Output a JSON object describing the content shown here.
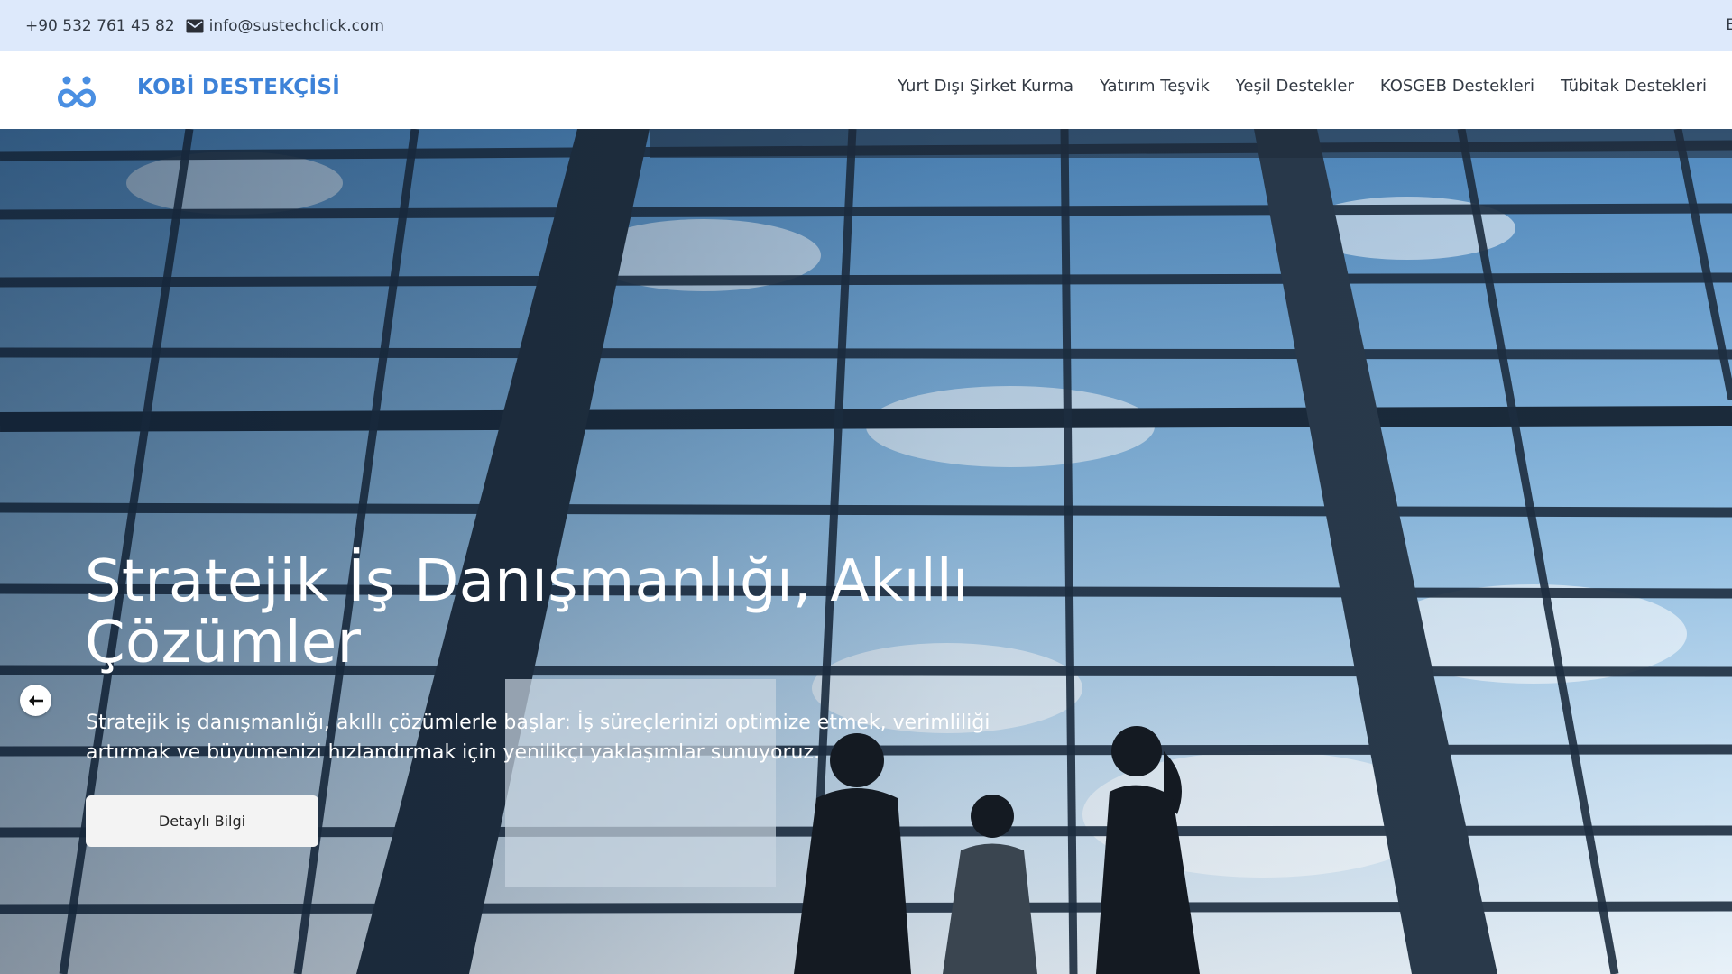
{
  "topbar": {
    "phone": "+90 532 761 45 82",
    "email": "info@sustechclick.com",
    "edge_char": "E"
  },
  "header": {
    "brand": "KOBİ DESTEKÇİSİ",
    "nav": [
      {
        "label": "Yurt Dışı Şirket Kurma"
      },
      {
        "label": "Yatırım Teşvik"
      },
      {
        "label": "Yeşil Destekler"
      },
      {
        "label": "KOSGEB Destekleri"
      },
      {
        "label": "Tübitak Destekleri"
      }
    ]
  },
  "hero": {
    "title": "Stratejik İş Danışmanlığı, Akıllı Çözümler",
    "description": "Stratejik iş danışmanlığı, akıllı çözümlerle başlar: İş süreçlerinizi optimize etmek, verimliliği artırmak ve büyümenizi hızlandırmak için yenilikçi yaklaşımlar sunuyoruz.",
    "button_label": "Detaylı Bilgi"
  },
  "colors": {
    "topbar_bg": "#dde9fb",
    "brand": "#3d82d8",
    "nav_text": "#333a44",
    "button_bg": "#f3f3f3"
  },
  "icons": {
    "mail": "mail-icon",
    "logo": "infinity-people-logo-icon",
    "prev": "arrow-left-icon"
  }
}
